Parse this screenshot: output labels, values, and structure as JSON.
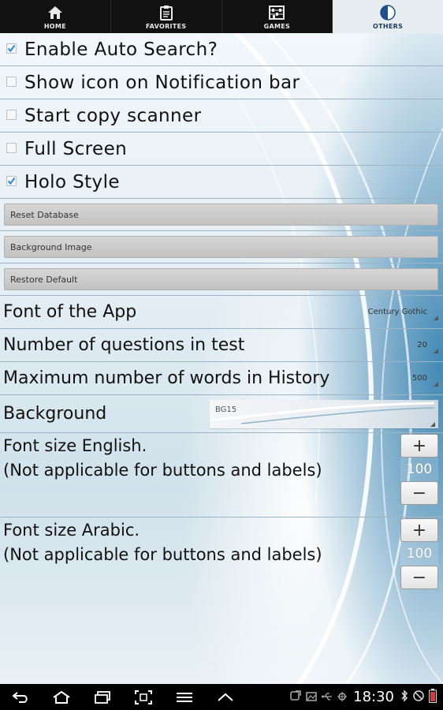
{
  "tabs": [
    {
      "label": "HOME",
      "icon": "home-icon"
    },
    {
      "label": "FAVORITES",
      "icon": "clipboard-icon"
    },
    {
      "label": "GAMES",
      "icon": "abacus-icon"
    },
    {
      "label": "OTHERS",
      "icon": "pie-icon",
      "active": true
    }
  ],
  "settings": {
    "enable_auto_search": {
      "label": "Enable Auto Search?",
      "checked": true
    },
    "show_notification_icon": {
      "label": "Show icon on Notification bar",
      "checked": false
    },
    "copy_scanner": {
      "label": "Start copy scanner",
      "checked": false
    },
    "full_screen": {
      "label": "Full Screen",
      "checked": false
    },
    "holo_style": {
      "label": "Holo Style",
      "checked": true
    }
  },
  "buttons": {
    "reset_database": "Reset Database",
    "background_image": "Background Image",
    "restore_default": "Restore Default"
  },
  "font_app": {
    "label": "Font of the App",
    "value": "Century Gothic"
  },
  "num_questions": {
    "label": "Number of questions in test",
    "value": "20"
  },
  "max_history": {
    "label": "Maximum number of words in History",
    "value": "500"
  },
  "background": {
    "label": "Background",
    "value": "BG15"
  },
  "font_size_english": {
    "line1": "Font size English.",
    "line2": "(Not applicable for buttons and labels)",
    "plus": "+",
    "value": "100",
    "minus": "−"
  },
  "font_size_arabic": {
    "line1": "Font size Arabic.",
    "line2": "(Not applicable for buttons and labels)",
    "plus": "+",
    "value": "100",
    "minus": "−"
  },
  "status_bar": {
    "time": "18:30"
  },
  "colors": {
    "accent_check": "#2f8fd6",
    "active_tab": "#e7edf1",
    "tab_bar": "#111111"
  }
}
